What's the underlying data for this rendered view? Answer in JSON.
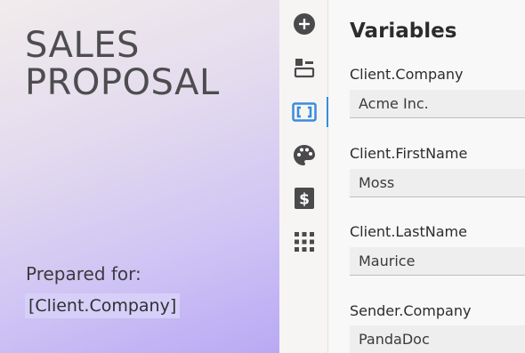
{
  "document": {
    "title_line1": "SALES",
    "title_line2": "PROPOSAL",
    "prepared_label": "Prepared for:",
    "client_token": "[Client.Company]"
  },
  "toolbar": {
    "items": [
      {
        "name": "add-icon",
        "active": false
      },
      {
        "name": "blocks-icon",
        "active": false
      },
      {
        "name": "variables-icon",
        "active": true
      },
      {
        "name": "palette-icon",
        "active": false
      },
      {
        "name": "pricing-icon",
        "active": false
      },
      {
        "name": "apps-grid-icon",
        "active": false
      }
    ],
    "active_color": "#3a8cd9"
  },
  "panel": {
    "title": "Variables",
    "variables": [
      {
        "label": "Client.Company",
        "value": "Acme Inc."
      },
      {
        "label": "Client.FirstName",
        "value": "Moss"
      },
      {
        "label": "Client.LastName",
        "value": "Maurice"
      },
      {
        "label": "Sender.Company",
        "value": "PandaDoc"
      }
    ]
  }
}
